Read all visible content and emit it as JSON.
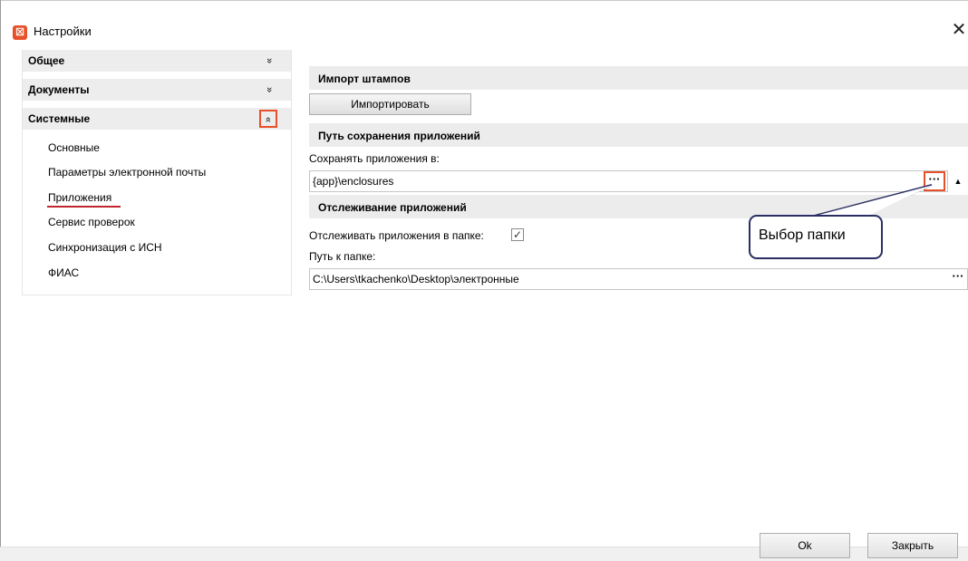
{
  "window": {
    "title": "Настройки",
    "app_icon": "app-logo-icon",
    "close_symbol": "✕"
  },
  "nav": {
    "groups": [
      {
        "label": "Общее",
        "chevron": "»",
        "expanded": false
      },
      {
        "label": "Документы",
        "chevron": "»",
        "expanded": false
      },
      {
        "label": "Системные",
        "chevron": "«",
        "expanded": true
      }
    ],
    "items": [
      "Основные",
      "Параметры электронной почты",
      "Приложения",
      "Сервис проверок",
      "Синхронизация с ИСН",
      "ФИАС"
    ],
    "selected": "Приложения"
  },
  "main": {
    "import_section": {
      "title": "Импорт штампов",
      "button": "Импортировать"
    },
    "path_section": {
      "title": "Путь сохранения приложений",
      "save_label": "Сохранять приложения в:",
      "save_value": "{app}\\enclosures",
      "browse": "···",
      "collapse_arrow": "▲"
    },
    "tracking_section": {
      "title": "Отслеживание приложений",
      "track_label": "Отслеживать приложения в папке:",
      "track_checked": true,
      "path_label": "Путь к папке:",
      "path_value": "C:\\Users\\tkachenko\\Desktop\\электронные",
      "browse": "···"
    }
  },
  "callout": {
    "text": "Выбор папки"
  },
  "footer": {
    "ok": "Ok",
    "close": "Закрыть"
  },
  "colors": {
    "accent": "#e8502a",
    "callout": "#2a2e62",
    "underline": "#c0282d"
  }
}
